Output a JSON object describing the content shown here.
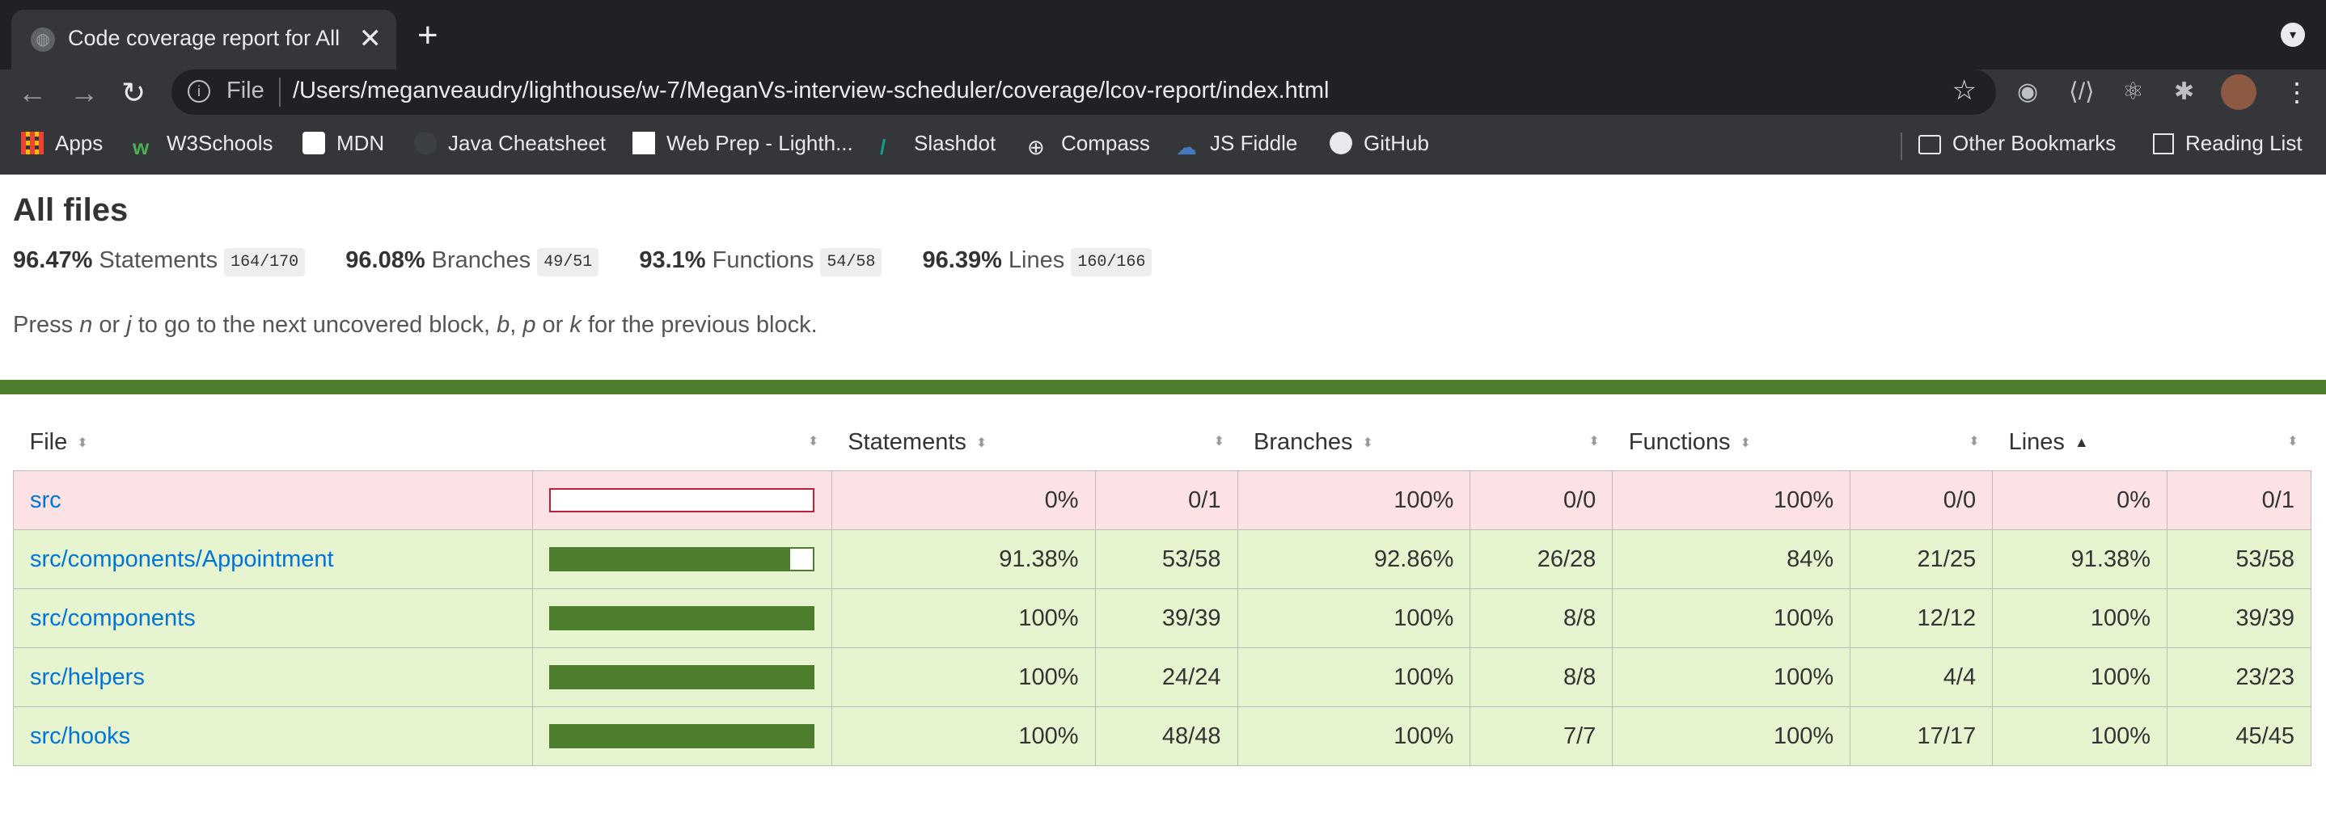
{
  "browser": {
    "tab_title": "Code coverage report for All files",
    "tab_close": "✕",
    "new_tab": "+",
    "url_scheme": "File",
    "url": "/Users/meganveaudry/lighthouse/w-7/MeganVs-interview-scheduler/coverage/lcov-report/index.html",
    "bookmarks": [
      "Apps",
      "W3Schools",
      "MDN",
      "Java Cheatsheet",
      "Web Prep - Lighth...",
      "Slashdot",
      "Compass",
      "JS Fiddle",
      "GitHub"
    ],
    "other_bookmarks": "Other Bookmarks",
    "reading_list": "Reading List"
  },
  "report": {
    "title": "All files",
    "summary": [
      {
        "pct": "96.47%",
        "label": "Statements",
        "frac": "164/170"
      },
      {
        "pct": "96.08%",
        "label": "Branches",
        "frac": "49/51"
      },
      {
        "pct": "93.1%",
        "label": "Functions",
        "frac": "54/58"
      },
      {
        "pct": "96.39%",
        "label": "Lines",
        "frac": "160/166"
      }
    ],
    "hint": {
      "pre": "Press ",
      "k1": "n",
      "mid1": " or ",
      "k2": "j",
      "mid2": " to go to the next uncovered block, ",
      "k3": "b",
      "mid3": ", ",
      "k4": "p",
      "mid4": " or ",
      "k5": "k",
      "post": " for the previous block."
    },
    "headers": {
      "file": "File",
      "statements": "Statements",
      "branches": "Branches",
      "functions": "Functions",
      "lines": "Lines"
    },
    "rows": [
      {
        "file": "src",
        "coverage": 0,
        "s_pct": "0%",
        "s_frac": "0/1",
        "b_pct": "100%",
        "b_frac": "0/0",
        "f_pct": "100%",
        "f_frac": "0/0",
        "l_pct": "0%",
        "l_frac": "0/1",
        "status": "low"
      },
      {
        "file": "src/components/Appointment",
        "coverage": 91.38,
        "s_pct": "91.38%",
        "s_frac": "53/58",
        "b_pct": "92.86%",
        "b_frac": "26/28",
        "f_pct": "84%",
        "f_frac": "21/25",
        "l_pct": "91.38%",
        "l_frac": "53/58",
        "status": "high"
      },
      {
        "file": "src/components",
        "coverage": 100,
        "s_pct": "100%",
        "s_frac": "39/39",
        "b_pct": "100%",
        "b_frac": "8/8",
        "f_pct": "100%",
        "f_frac": "12/12",
        "l_pct": "100%",
        "l_frac": "39/39",
        "status": "high"
      },
      {
        "file": "src/helpers",
        "coverage": 100,
        "s_pct": "100%",
        "s_frac": "24/24",
        "b_pct": "100%",
        "b_frac": "8/8",
        "f_pct": "100%",
        "f_frac": "4/4",
        "l_pct": "100%",
        "l_frac": "23/23",
        "status": "high"
      },
      {
        "file": "src/hooks",
        "coverage": 100,
        "s_pct": "100%",
        "s_frac": "48/48",
        "b_pct": "100%",
        "b_frac": "7/7",
        "f_pct": "100%",
        "f_frac": "17/17",
        "l_pct": "100%",
        "l_frac": "45/45",
        "status": "high"
      }
    ]
  },
  "colors": {
    "high_bg": "#e6f5d0",
    "low_bg": "#fce1e5",
    "bar": "#4d7e2e",
    "link": "#0074d9"
  }
}
